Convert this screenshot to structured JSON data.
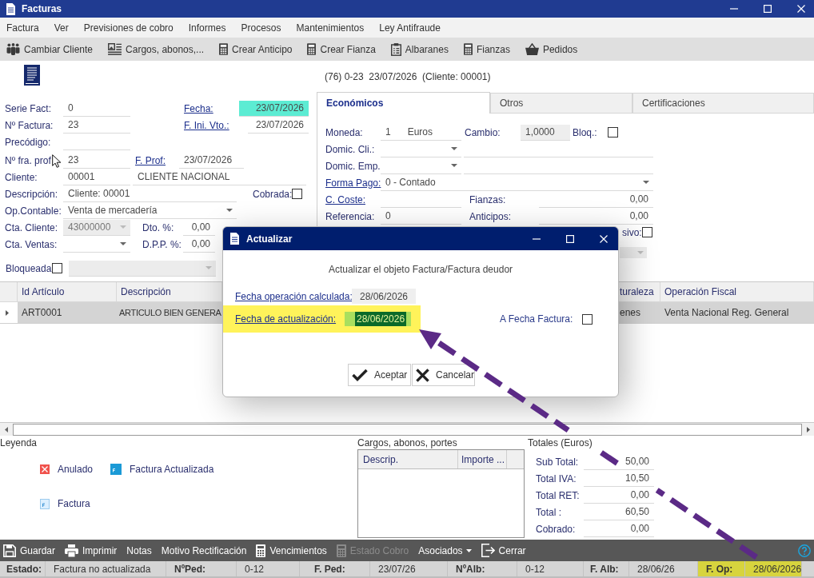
{
  "window": {
    "title": "Facturas"
  },
  "menu": [
    "Factura",
    "Ver",
    "Previsiones de cobro",
    "Informes",
    "Procesos",
    "Mantenimientos",
    "Ley Antifraude"
  ],
  "toolbar": [
    "Cambiar Cliente",
    "Cargos, abonos,...",
    "Crear Anticipo",
    "Crear Fianza",
    "Albaranes",
    "Fianzas",
    "Pedidos"
  ],
  "summary": "(76) 0-23  23/07/2026  (Cliente: 00001)",
  "form": {
    "serie_fact": {
      "label": "Serie Fact:",
      "value": "0"
    },
    "fecha": {
      "label": "Fecha:",
      "value": "23/07/2026",
      "highlighted": true
    },
    "n_factura": {
      "label": "Nº Factura:",
      "value": "23"
    },
    "f_ini_vto": {
      "label": "F. Ini. Vto.:",
      "value": "23/07/2026"
    },
    "precodigo": {
      "label": "Precódigo:"
    },
    "n_fra_prof": {
      "label": "Nº fra. prof",
      "value": "23"
    },
    "f_prof": {
      "label": "F. Prof:",
      "value": "23/07/2026"
    },
    "cliente": {
      "label": "Cliente:",
      "code": "00001",
      "name": "CLIENTE NACIONAL"
    },
    "descripcion": {
      "label": "Descripción:",
      "value": "Cliente: 00001"
    },
    "cobrada": {
      "label": "Cobrada:",
      "checked": false
    },
    "op_contable": {
      "label": "Op.Contable:",
      "value": "Venta de mercadería"
    },
    "cta_cliente": {
      "label": "Cta. Cliente:",
      "value": "43000000",
      "disabled": true
    },
    "dto": {
      "label": "Dto. %:",
      "value": "0,00"
    },
    "cta_ventas": {
      "label": "Cta. Ventas:",
      "disabled": false
    },
    "dpp": {
      "label": "D.P.P. %:",
      "value": "0,00"
    },
    "bloqueada": {
      "label": "Bloqueada",
      "checked": false,
      "combo_disabled": true
    }
  },
  "tabs": [
    {
      "label": "Económicos",
      "selected": true
    },
    {
      "label": "Otros",
      "selected": false
    },
    {
      "label": "Certificaciones",
      "selected": false
    }
  ],
  "economicos": {
    "moneda": {
      "label": "Moneda:",
      "code": "1",
      "name": "Euros"
    },
    "cambio": {
      "label": "Cambio:",
      "value": "1,0000"
    },
    "bloq": {
      "label": "Bloq.:",
      "checked": false
    },
    "domic_cli": {
      "label": "Domic. Cli.:"
    },
    "domic_emp": {
      "label": "Domic. Emp."
    },
    "forma_pago": {
      "label": "Forma Pago:",
      "value": "0 - Contado"
    },
    "c_coste": {
      "label": "C. Coste:"
    },
    "fianzas": {
      "label": "Fianzas:",
      "value": "0,00"
    },
    "referencia": {
      "label": "Referencia:",
      "value": "0"
    },
    "anticipos": {
      "label": "Anticipos:",
      "value": "0,00"
    },
    "row_7": {
      "label": "sivo:",
      "checked": false
    },
    "row_8": {
      "disabled": true
    }
  },
  "grid": {
    "columns": [
      "Id Artículo",
      "Descripción",
      "turaleza",
      "Operación Fiscal"
    ],
    "rows": [
      {
        "selected": true,
        "cells": [
          "ART0001",
          "ARTICULO BIEN GENERA",
          "enes",
          "Venta Nacional Reg. General"
        ]
      }
    ]
  },
  "legend": {
    "title": "Leyenda",
    "items": [
      {
        "kind": "cancelled",
        "label": "Anulado"
      },
      {
        "kind": "updated",
        "label": "Factura Actualizada"
      },
      {
        "kind": "normal",
        "label": "Factura"
      }
    ]
  },
  "cargos": {
    "title": "Cargos, abonos, portes",
    "columns": [
      "Descrip.",
      "Importe ..."
    ]
  },
  "totales": {
    "title": "Totales (Euros)",
    "rows": [
      {
        "label": "Sub Total:",
        "value": "50,00"
      },
      {
        "label": "Total IVA:",
        "value": "10,50"
      },
      {
        "label": "Total RET:",
        "value": "0,00"
      },
      {
        "label": "Total :",
        "value": "60,50"
      },
      {
        "label": "Cobrado:",
        "value": "0,00"
      }
    ]
  },
  "bottom_toolbar": [
    {
      "label": "Guardar",
      "kind": "button",
      "disabled": false
    },
    {
      "label": "Imprimir",
      "kind": "button",
      "disabled": false
    },
    {
      "label": "Notas",
      "kind": "button",
      "disabled": false
    },
    {
      "label": "Motivo Rectificación",
      "kind": "button",
      "disabled": false
    },
    {
      "label": "Vencimientos",
      "kind": "button",
      "disabled": false
    },
    {
      "label": "Estado Cobro",
      "kind": "button",
      "disabled": true
    },
    {
      "label": "Asociados",
      "kind": "menu",
      "disabled": false
    },
    {
      "label": "Cerrar",
      "kind": "button",
      "disabled": false
    }
  ],
  "status_bar": [
    {
      "label": "Estado:",
      "value": "Factura no actualizada",
      "highlighted": false
    },
    {
      "label": "NºPed:",
      "value": "0-12",
      "highlighted": false
    },
    {
      "label": "F. Ped:",
      "value": "23/07/26",
      "highlighted": false
    },
    {
      "label": "NºAlb:",
      "value": "0-12",
      "highlighted": false
    },
    {
      "label": "F. Alb:",
      "value": "28/06/26",
      "highlighted": false
    },
    {
      "label": "F. Op:",
      "value": "28/06/2026",
      "highlighted": true
    }
  ],
  "dialog": {
    "title": "Actualizar",
    "message": "Actualizar el objeto Factura/Factura deudor",
    "fecha_calculada": {
      "label": "Fecha operación calculada:",
      "value": "28/06/2026"
    },
    "fecha_actualizacion": {
      "label": "Fecha de actualización:",
      "value": "28/06/2026",
      "highlighted": true,
      "text_selected": true
    },
    "a_fecha_factura": {
      "label": "A Fecha Factura:",
      "checked": false
    },
    "buttons": [
      "Aceptar",
      "Cancelar"
    ]
  }
}
